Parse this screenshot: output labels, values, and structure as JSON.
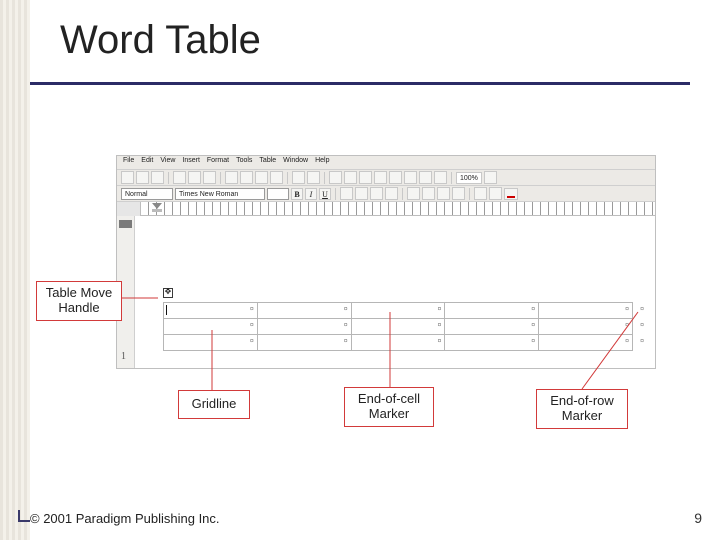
{
  "slide": {
    "title": "Word Table",
    "page_number": "9",
    "copyright": "© 2001 Paradigm Publishing Inc."
  },
  "callouts": {
    "move_handle": "Table Move Handle",
    "gridline": "Gridline",
    "end_of_cell": "End-of-cell Marker",
    "end_of_row": "End-of-row Marker"
  },
  "word": {
    "menus": [
      "File",
      "Edit",
      "View",
      "Insert",
      "Format",
      "Tools",
      "Table",
      "Window",
      "Help"
    ],
    "style": "Normal",
    "font": "Times New Roman",
    "zoom": "100%",
    "buttons": {
      "b": "B",
      "i": "I",
      "u": "U"
    },
    "ruler_number": "1",
    "table": {
      "rows": 3,
      "cols": 5
    }
  }
}
